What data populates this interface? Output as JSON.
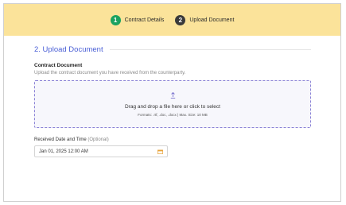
{
  "stepper": {
    "steps": [
      {
        "number": "1",
        "label": "Contract Details",
        "state": "complete"
      },
      {
        "number": "2",
        "label": "Upload Document",
        "state": "active"
      }
    ]
  },
  "section": {
    "title": "2. Upload Document"
  },
  "contract_document": {
    "label": "Contract Document",
    "help": "Upload the contract document you have received from the counterparty.",
    "dropzone": {
      "icon": "upload-arrow-icon",
      "main_text": "Drag and drop a file here or click to select",
      "sub_text": "Formats: .rtf, .doc, .docx | Max. Size: 10 MB"
    }
  },
  "received_date": {
    "label": "Received Date and Time",
    "optional_tag": "(Optional)",
    "value": "Jan 01, 2025 12:00 AM",
    "icon": "calendar-icon"
  },
  "colors": {
    "header_bg": "#fbe39a",
    "step_complete": "#1aa260",
    "step_active": "#3a3a3a",
    "accent": "#4a5fd6",
    "calendar_icon": "#e8a33a"
  }
}
